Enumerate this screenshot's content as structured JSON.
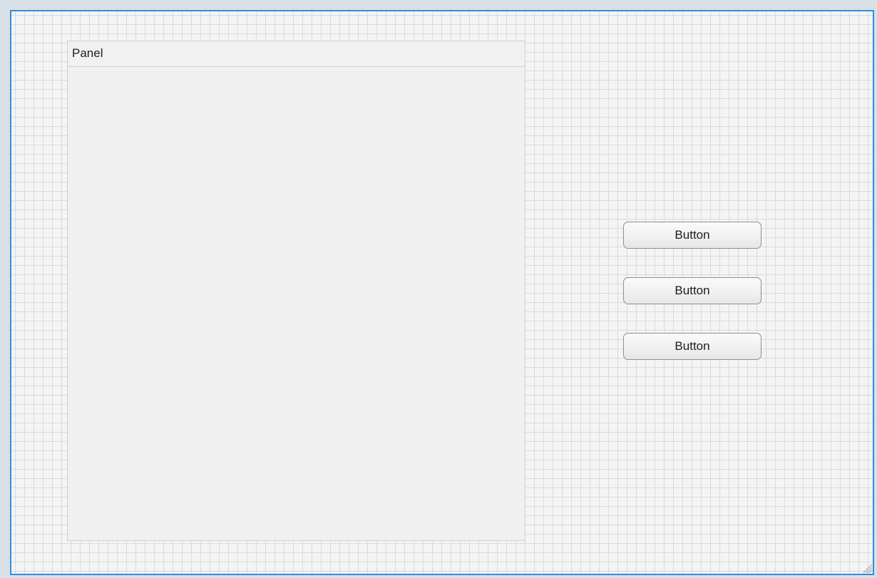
{
  "panel": {
    "title": "Panel"
  },
  "buttons": [
    {
      "label": "Button"
    },
    {
      "label": "Button"
    },
    {
      "label": "Button"
    }
  ],
  "colors": {
    "canvas_border": "#2f8fe0",
    "canvas_background": "#f4f4f4",
    "grid_line": "#dadada",
    "panel_background": "#f0f0f0"
  },
  "icons": {
    "resize_grip": "resize-grip-icon"
  }
}
